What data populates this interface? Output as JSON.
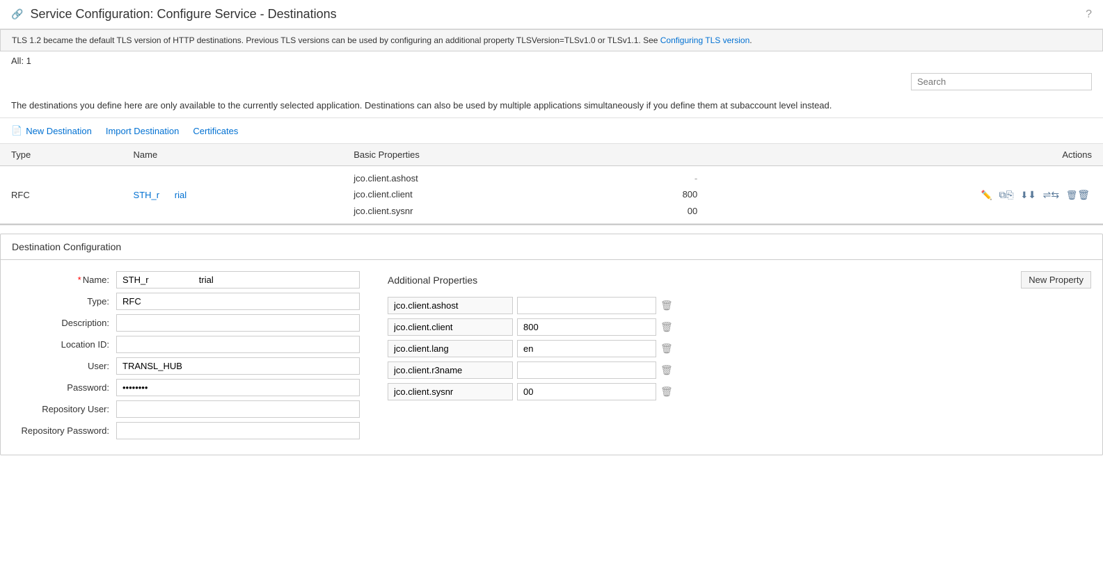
{
  "header": {
    "title": "Service Configuration: Configure Service - Destinations",
    "help_icon": "?"
  },
  "banner": {
    "text": "TLS 1.2 became the default TLS version of HTTP destinations. Previous TLS versions can be used by configuring an additional property TLSVersion=TLSv1.0 or TLSv1.1. See ",
    "link_text": "Configuring TLS version",
    "link_url": "#"
  },
  "count": "All: 1",
  "search": {
    "placeholder": "Search"
  },
  "description": "The destinations you define here are only available to the currently selected application. Destinations can also be used by multiple applications simultaneously if you define them at subaccount level instead.",
  "toolbar": {
    "new_destination": "New Destination",
    "import_destination": "Import Destination",
    "certificates": "Certificates"
  },
  "table": {
    "columns": [
      "Type",
      "Name",
      "Basic Properties",
      "",
      "Actions"
    ],
    "rows": [
      {
        "type": "RFC",
        "name_part1": "STH_r",
        "name_part2": "rial",
        "properties": [
          "jco.client.ashost",
          "jco.client.client",
          "jco.client.sysnr"
        ],
        "values": [
          "-",
          "800",
          "00"
        ]
      }
    ]
  },
  "destination_config": {
    "title": "Destination Configuration",
    "form": {
      "name_label": "Name:",
      "name_required": true,
      "name_value": "STH_r                    trial",
      "type_label": "Type:",
      "type_value": "RFC",
      "description_label": "Description:",
      "description_value": "",
      "location_id_label": "Location ID:",
      "location_id_value": "",
      "user_label": "User:",
      "user_value": "TRANSL_HUB",
      "password_label": "Password:",
      "password_value": "••••••••",
      "repo_user_label": "Repository User:",
      "repo_user_value": "",
      "repo_password_label": "Repository Password:",
      "repo_password_value": ""
    },
    "additional_properties": {
      "title": "Additional Properties",
      "new_property_btn": "New Property",
      "properties": [
        {
          "name": "jco.client.ashost",
          "value": ""
        },
        {
          "name": "jco.client.client",
          "value": "800"
        },
        {
          "name": "jco.client.lang",
          "value": "en"
        },
        {
          "name": "jco.client.r3name",
          "value": ""
        },
        {
          "name": "jco.client.sysnr",
          "value": "00"
        }
      ]
    }
  }
}
